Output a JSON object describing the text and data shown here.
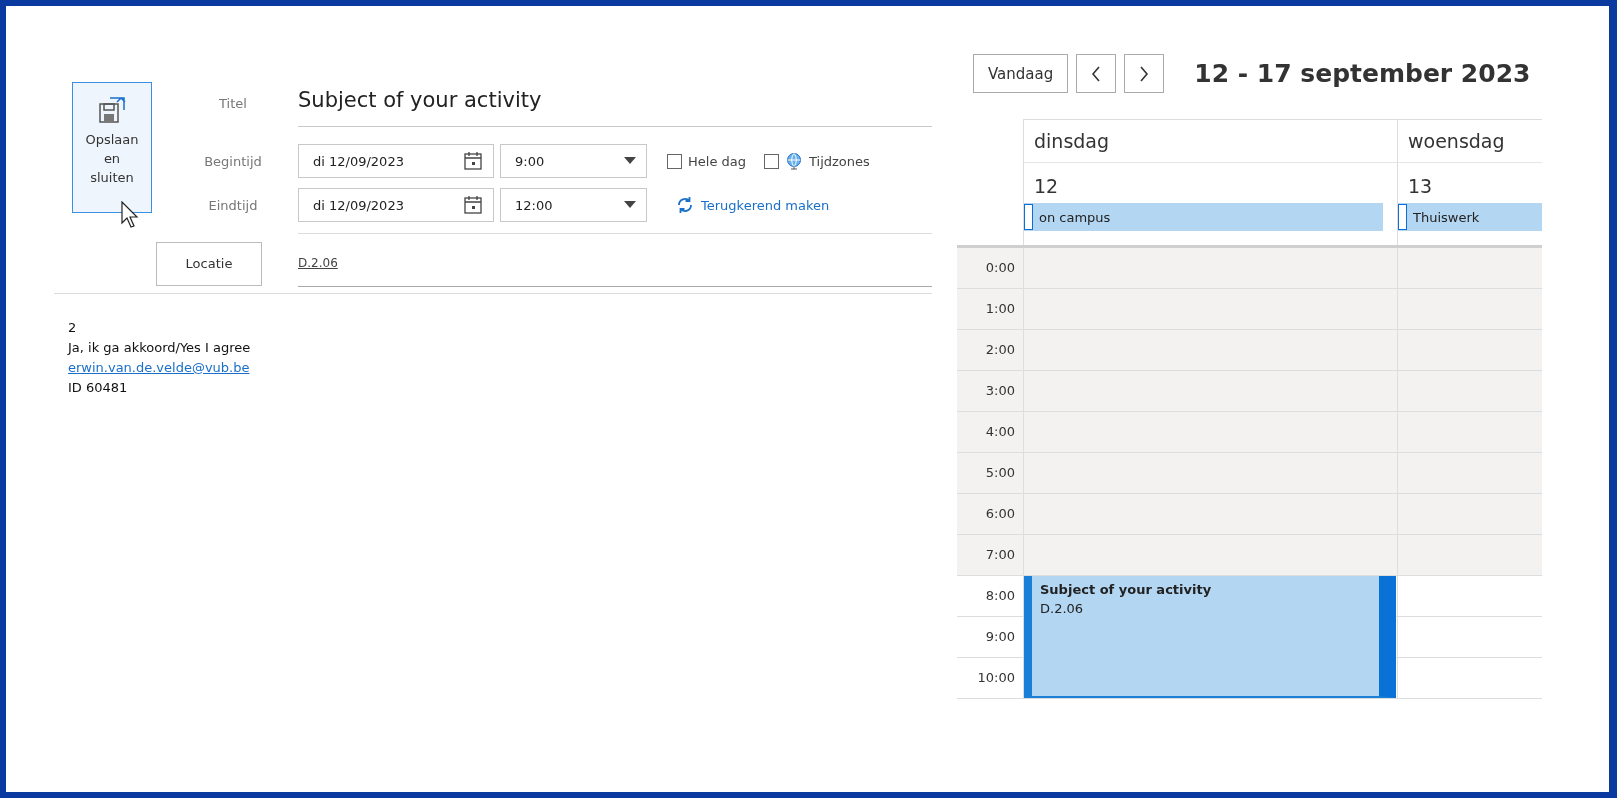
{
  "form": {
    "save_button": {
      "label": "Opslaan en sluiten"
    },
    "title": {
      "label": "Titel",
      "value": "Subject of your activity"
    },
    "start": {
      "label": "Begintijd",
      "date": "di 12/09/2023",
      "time": "9:00"
    },
    "end": {
      "label": "Eindtijd",
      "date": "di 12/09/2023",
      "time": "12:00"
    },
    "options": [
      {
        "label": "Hele dag",
        "checked": false,
        "kind": "plain"
      },
      {
        "label": "Tijdzones",
        "checked": false,
        "kind": "globe"
      }
    ],
    "recurrence_link": "Terugkerend maken",
    "location": {
      "button": "Locatie",
      "value": "D.2.06"
    },
    "body": {
      "lines": [
        {
          "text": "2",
          "kind": "text"
        },
        {
          "text": "Ja, ik ga akkoord/Yes I agree",
          "kind": "text"
        },
        {
          "text": "erwin.van.de.velde@vub.be",
          "kind": "link"
        },
        {
          "text": "ID 60481",
          "kind": "text"
        }
      ]
    }
  },
  "calendar": {
    "today_button": "Vandaag",
    "range": "12 - 17 september 2023",
    "days": [
      {
        "name": "dinsdag",
        "number": "12",
        "all_day": "on campus"
      },
      {
        "name": "woensdag",
        "number": "13",
        "all_day": "Thuiswerk"
      }
    ],
    "hours": [
      {
        "label": "0:00",
        "work": false
      },
      {
        "label": "1:00",
        "work": false
      },
      {
        "label": "2:00",
        "work": false
      },
      {
        "label": "3:00",
        "work": false
      },
      {
        "label": "4:00",
        "work": false
      },
      {
        "label": "5:00",
        "work": false
      },
      {
        "label": "6:00",
        "work": false
      },
      {
        "label": "7:00",
        "work": false
      },
      {
        "label": "8:00",
        "work": true
      },
      {
        "label": "9:00",
        "work": true
      },
      {
        "label": "10:00",
        "work": true
      }
    ],
    "event": {
      "title": "Subject of your activity",
      "location": "D.2.06"
    }
  }
}
